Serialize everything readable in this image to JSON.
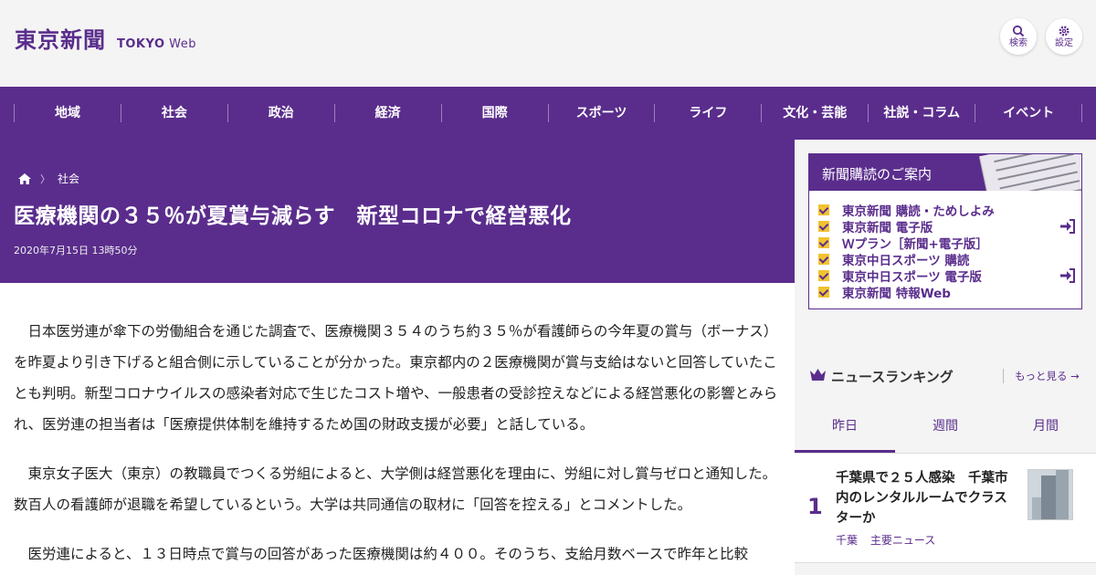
{
  "header": {
    "logo_jp": "東京新聞",
    "logo_en_bold": "TOKYO",
    "logo_en_light": "Web",
    "search_label": "検索",
    "settings_label": "設定"
  },
  "nav": [
    "地域",
    "社会",
    "政治",
    "経済",
    "国際",
    "スポーツ",
    "ライフ",
    "文化・芸能",
    "社説・コラム",
    "イベント"
  ],
  "breadcrumb": {
    "section": "社会"
  },
  "article": {
    "headline": "医療機関の３５％が夏賞与減らす　新型コロナで経営悪化",
    "date": "2020年7月15日 13時50分",
    "paragraphs": [
      "日本医労連が傘下の労働組合を通じた調査で、医療機関３５４のうち約３５％が看護師らの今年夏の賞与（ボーナス）を昨夏より引き下げると組合側に示していることが分かった。東京都内の２医療機関が賞与支給はないと回答していたことも判明。新型コロナウイルスの感染者対応で生じたコスト増や、一般患者の受診控えなどによる経営悪化の影響とみられ、医労連の担当者は「医療提供体制を維持するため国の財政支援が必要」と話している。",
      "東京女子医大（東京）の教職員でつくる労組によると、大学側は経営悪化を理由に、労組に対し賞与ゼロと通知した。数百人の看護師が退職を希望しているという。大学は共同通信の取材に「回答を控える」とコメントした。",
      "医労連によると、１３日時点で賞与の回答があった医療機関は約４００。そのうち、支給月数ベースで昨年と比較"
    ]
  },
  "subscribe": {
    "title": "新聞購読のご案内",
    "items": [
      {
        "label": "東京新聞 購読・ためしよみ",
        "login": false
      },
      {
        "label": "東京新聞 電子版",
        "login": true
      },
      {
        "label": "Ｗプラン［新聞+電子版］",
        "login": false
      },
      {
        "label": "東京中日スポーツ 購読",
        "login": false
      },
      {
        "label": "東京中日スポーツ 電子版",
        "login": true
      },
      {
        "label": "東京新聞 特報Web",
        "login": false
      }
    ]
  },
  "ranking": {
    "title": "ニュースランキング",
    "more": "もっと見る",
    "tabs": [
      "昨日",
      "週間",
      "月間"
    ],
    "active_tab": 0,
    "items": [
      {
        "rank": "1",
        "title": "千葉県で２５人感染　千葉市内のレンタルルームでクラスターか",
        "tags": [
          "千葉",
          "主要ニュース"
        ]
      }
    ]
  },
  "colors": {
    "brand": "#5a2d8c",
    "check": "#f2c230"
  }
}
